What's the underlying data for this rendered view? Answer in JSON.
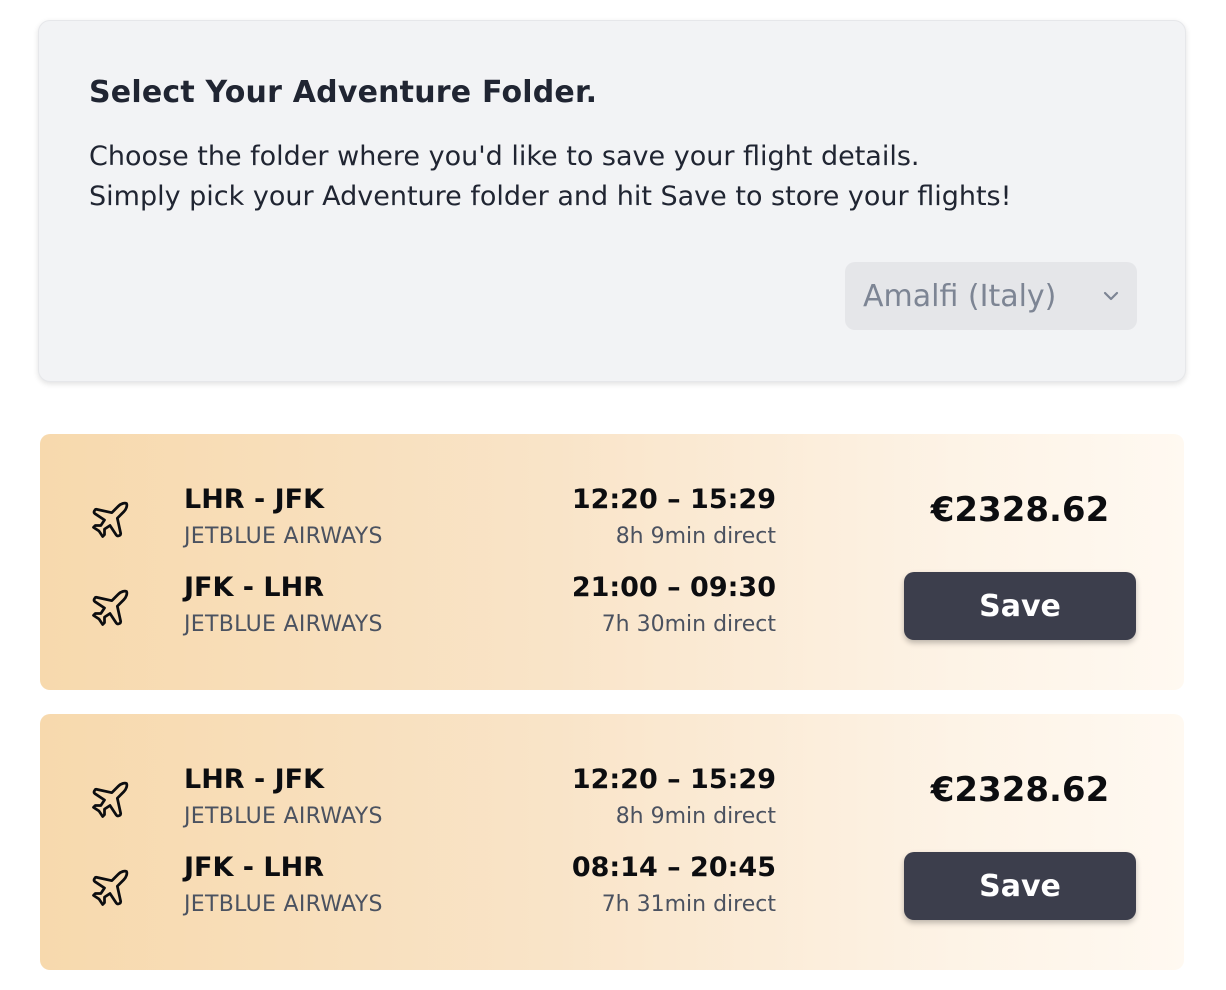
{
  "folder": {
    "title": "Select Your Adventure Folder.",
    "description_line1": "Choose the folder where you'd like to save your flight details.",
    "description_line2": "Simply pick your Adventure folder and hit Save to store your flights!",
    "selected_folder": "Amalfi (Italy)"
  },
  "flights": [
    {
      "price": "€2328.62",
      "save_label": "Save",
      "legs": [
        {
          "route": "LHR - JFK",
          "airline": "JETBLUE AIRWAYS",
          "times": "12:20 – 15:29",
          "duration": "8h 9min direct",
          "icon": "airplane-icon"
        },
        {
          "route": "JFK - LHR",
          "airline": "JETBLUE AIRWAYS",
          "times": "21:00 – 09:30",
          "duration": "7h 30min direct",
          "icon": "airplane-icon"
        }
      ]
    },
    {
      "price": "€2328.62",
      "save_label": "Save",
      "legs": [
        {
          "route": "LHR - JFK",
          "airline": "JETBLUE AIRWAYS",
          "times": "12:20 – 15:29",
          "duration": "8h 9min direct",
          "icon": "airplane-icon"
        },
        {
          "route": "JFK - LHR",
          "airline": "JETBLUE AIRWAYS",
          "times": "08:14 – 20:45",
          "duration": "7h 31min direct",
          "icon": "airplane-icon"
        }
      ]
    }
  ],
  "colors": {
    "card_gradient_start": "#f7d9ad",
    "card_gradient_end": "#fff9f1",
    "save_button": "#3c3e4c",
    "panel_bg": "#f2f3f5"
  }
}
